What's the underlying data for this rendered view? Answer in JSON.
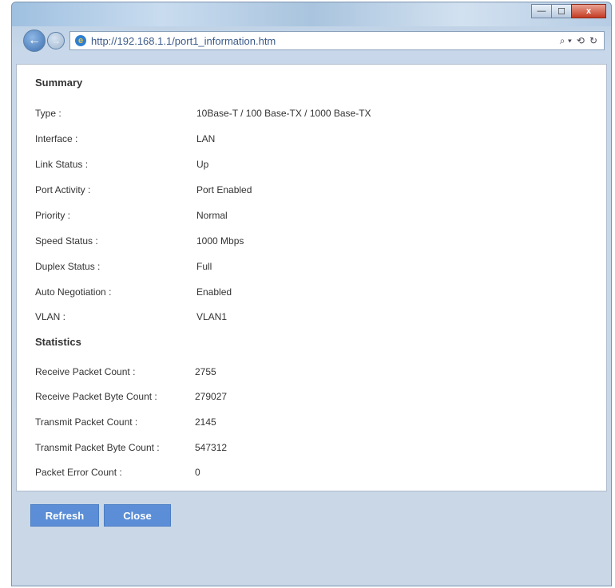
{
  "browser": {
    "url": "http://192.168.1.1/port1_information.htm",
    "window_controls": {
      "minimize": "—",
      "maximize": "☐",
      "close": "x"
    },
    "tools": [
      "⌕ ▾",
      "⟲",
      "↻"
    ]
  },
  "summary": {
    "title": "Summary",
    "rows": [
      {
        "label": "Type :",
        "value": "10Base-T / 100 Base-TX / 1000 Base-TX"
      },
      {
        "label": "Interface :",
        "value": "LAN"
      },
      {
        "label": "Link Status :",
        "value": "Up"
      },
      {
        "label": "Port Activity :",
        "value": "Port Enabled"
      },
      {
        "label": "Priority :",
        "value": "Normal"
      },
      {
        "label": "Speed Status :",
        "value": "1000 Mbps"
      },
      {
        "label": "Duplex Status :",
        "value": "Full"
      },
      {
        "label": "Auto Negotiation :",
        "value": "Enabled"
      },
      {
        "label": "VLAN :",
        "value": "VLAN1"
      }
    ]
  },
  "statistics": {
    "title": "Statistics",
    "rows": [
      {
        "label": "Receive Packet Count :",
        "value": "2755"
      },
      {
        "label": "Receive Packet Byte Count :",
        "value": "279027"
      },
      {
        "label": "Transmit Packet Count :",
        "value": "2145"
      },
      {
        "label": "Transmit Packet Byte Count :",
        "value": "547312"
      },
      {
        "label": "Packet Error Count :",
        "value": "0"
      }
    ]
  },
  "buttons": {
    "refresh": "Refresh",
    "close": "Close"
  },
  "colors": {
    "button": "#5b8ed6",
    "frame": "#c9d7e6"
  }
}
